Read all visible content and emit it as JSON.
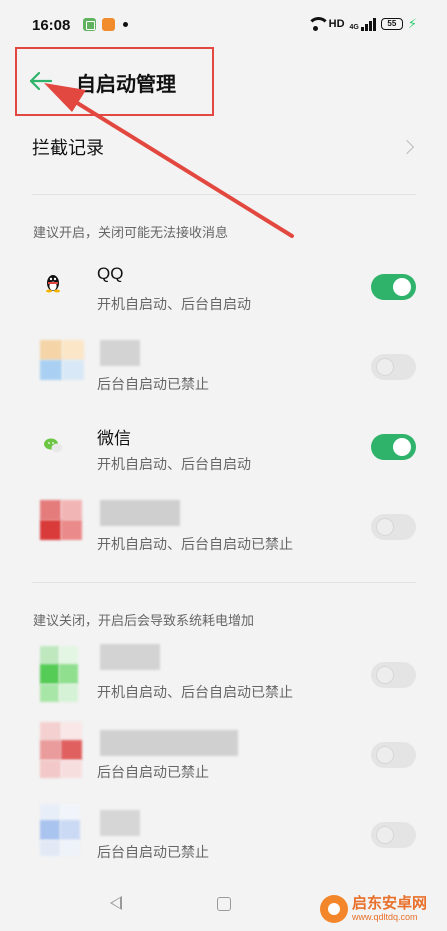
{
  "status_bar": {
    "time": "16:08",
    "network": "HD",
    "network_type": "4G",
    "battery": "55"
  },
  "header": {
    "title": "自启动管理"
  },
  "intercept": {
    "label": "拦截记录"
  },
  "sections": [
    {
      "header": "建议开启，关闭可能无法接收消息",
      "apps": [
        {
          "name": "QQ",
          "status": "开机自启动、后台自启动",
          "enabled": true,
          "icon": "qq-icon"
        },
        {
          "name": "",
          "status": "后台自启动已禁止",
          "enabled": false,
          "icon": "blurred-app-icon"
        },
        {
          "name": "微信",
          "status": "开机自启动、后台自启动",
          "enabled": true,
          "icon": "wechat-icon"
        },
        {
          "name": "",
          "status": "开机自启动、后台自启动已禁止",
          "enabled": false,
          "icon": "blurred-app-icon"
        }
      ]
    },
    {
      "header": "建议关闭，开启后会导致系统耗电增加",
      "apps": [
        {
          "name": "",
          "status": "开机自启动、后台自启动已禁止",
          "enabled": false,
          "icon": "blurred-app-icon"
        },
        {
          "name": "",
          "status": "后台自启动已禁止",
          "enabled": false,
          "icon": "blurred-app-icon"
        },
        {
          "name": "",
          "status": "后台自启动已禁止",
          "enabled": false,
          "icon": "blurred-app-icon"
        }
      ]
    }
  ],
  "watermark": {
    "name": "启东安卓网",
    "url": "www.qdltdq.com"
  },
  "colors": {
    "toggle_on": "#2fb36a",
    "back_arrow": "#2fb36a",
    "annotation_red": "#e2483f"
  }
}
